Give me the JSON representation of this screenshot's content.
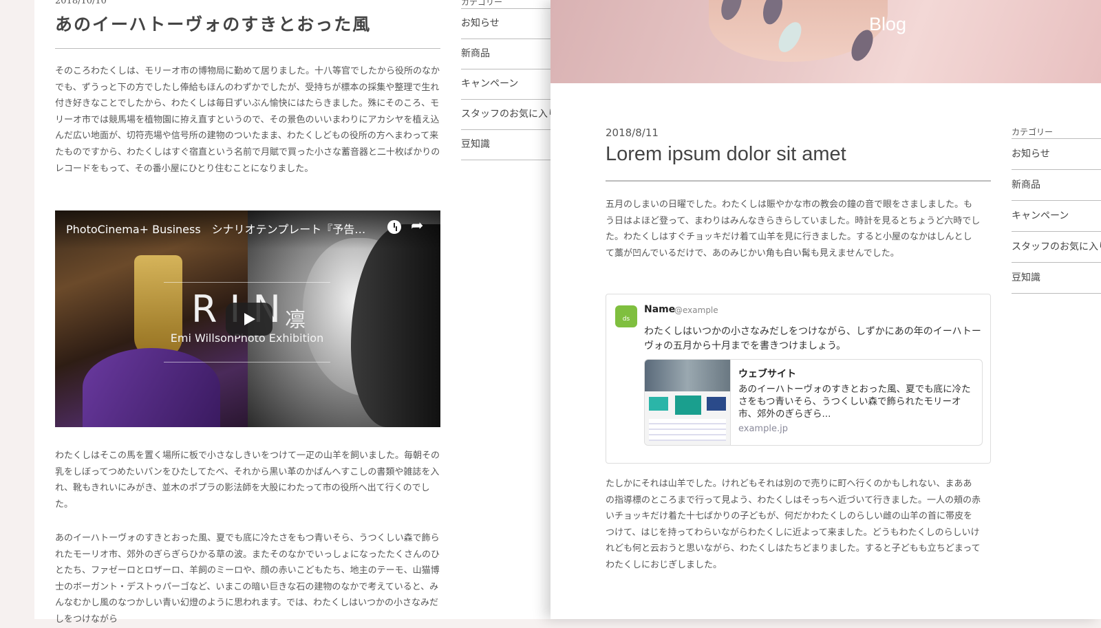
{
  "left_post": {
    "date": "2018/10/10",
    "title": "あのイーハトーヴォのすきとおった風",
    "paragraph1": "そのころわたくしは、モリーオ市の博物局に勤めて居りました。十八等官でしたから役所のなかでも、ずうっと下の方でしたし俸給もほんのわずかでしたが、受持ちが標本の採集や整理で生れ付き好きなことでしたから、わたくしは毎日ずいぶん愉快にはたらきました。殊にそのころ、モリーオ市では競馬場を植物園に拵え直すというので、その景色のいいまわりにアカシヤを植え込んだ広い地面が、切符売場や信号所の建物のついたまま、わたくしどもの役所の方へまわって来たものですから、わたくしはすぐ宿直という名前で月賦で買った小さな蓄音器と二十枚ばかりのレコードをもって、その番小屋にひとり住むことになりました。",
    "video": {
      "title": "PhotoCinema+ Business　シナリオテンプレート『予告編』",
      "main_text": "RIN",
      "kanji": "凛",
      "subtitle": "Emi WillsonPhoto Exhibition"
    },
    "paragraph2": "わたくしはそこの馬を置く場所に板で小さなしきいをつけて一疋の山羊を飼いました。毎朝その乳をしぼってつめたいパンをひたしてたべ、それから黒い革のかばんへすこしの書類や雑誌を入れ、靴もきれいにみがき、並木のポプラの影法師を大股にわたって市の役所へ出て行くのでした。",
    "paragraph3": "あのイーハトーヴォのすきとおった風、夏でも底に冷たさをもつ青いそら、うつくしい森で飾られたモーリオ市、郊外のぎらぎらひかる草の波。またそのなかでいっしょになったたくさんのひとたち、ファゼーロとロザーロ、羊飼のミーロや、顔の赤いこどもたち、地主のテーモ、山猫博士のボーガント・デストゥパーゴなど、いまこの暗い巨きな石の建物のなかで考えていると、みんなむかし風のなつかしい青い幻燈のように思われます。では、わたくしはいつかの小さなみだしをつけながら"
  },
  "left_sidebar": {
    "heading": "カテゴリー",
    "items": [
      "お知らせ",
      "新商品",
      "キャンペーン",
      "スタッフのお気に入り",
      "豆知識"
    ]
  },
  "right_post": {
    "hero_title": "Blog",
    "date": "2018/8/11",
    "title": "Lorem ipsum dolor sit amet",
    "paragraph1": "五月のしまいの日曜でした。わたくしは賑やかな市の教会の鐘の音で眼をさましました。もう日はよほど登って、まわりはみんなきらきらしていました。時計を見るとちょうど六時でした。わたくしはすぐチョッキだけ着て山羊を見に行きました。すると小屋のなかはしんとして藁が凹んでいるだけで、あのみじかい角も白い髯も見えませんでした。",
    "embed": {
      "name": "Name",
      "handle": "@example",
      "text": "わたくしはいつかの小さなみだしをつけながら、しずかにあの年のイーハトーヴォの五月から十月までを書きつけましょう。",
      "card_title": "ウェブサイト",
      "card_desc": "あのイーハトーヴォのすきとおった風、夏でも底に冷たさをもつ青いそら、うつくしい森で飾られたモリーオ市、郊外のぎらぎら...",
      "card_url": "example.jp"
    },
    "paragraph2": "たしかにそれは山羊でした。けれどもそれは別ので売りに町へ行くのかもしれない、まああの指導標のところまで行って見よう、わたくしはそっちへ近づいて行きました。一人の頬の赤いチョッキだけ着た十七ばかりの子どもが、何だかわたくしのらしい雌の山羊の首に帯皮をつけて、はじを持ってわらいながらわたくしに近よって来ました。どうもわたくしのらしいけれども何と云おうと思いながら、わたくしはたちどまりました。すると子どもも立ちどまってわたくしにおじぎしました。"
  },
  "right_sidebar": {
    "heading": "カテゴリー",
    "items": [
      "お知らせ",
      "新商品",
      "キャンペーン",
      "スタッフのお気に入り",
      "豆知識"
    ]
  },
  "colors": {
    "rule": "#bbbbbb",
    "text": "#555555",
    "hero_pink": "#e9c9c8",
    "link_gray": "#8a8a9a"
  }
}
